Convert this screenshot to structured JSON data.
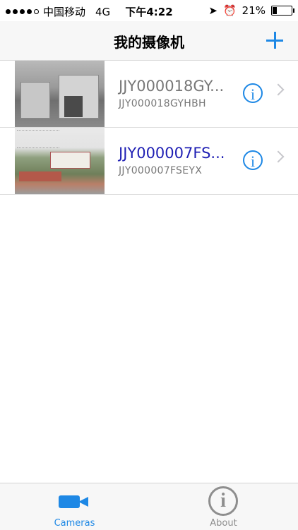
{
  "status_bar": {
    "carrier": "中国移动",
    "network": "4G",
    "time": "下午4:22",
    "battery": "21%",
    "icons": [
      "signal-dots-icon",
      "location-arrow-icon",
      "alarm-icon",
      "battery-icon"
    ],
    "battery_level": 0.21
  },
  "nav": {
    "title": "我的摄像机",
    "add_icon": "plus-icon"
  },
  "cameras": [
    {
      "name": "JJY000018GY...",
      "id": "JJY000018GYHBH"
    },
    {
      "name": "JJY000007FS...",
      "id": "JJY000007FSEYX"
    }
  ],
  "tabs": [
    {
      "label": "Cameras",
      "icon": "video-camera-icon",
      "selected": true
    },
    {
      "label": "About",
      "icon": "info-circle-icon",
      "selected": false
    }
  ],
  "colors": {
    "accent": "#1e88e5",
    "camera_name_gray": "#777777",
    "camera_name_blue": "#1f1fb4"
  }
}
